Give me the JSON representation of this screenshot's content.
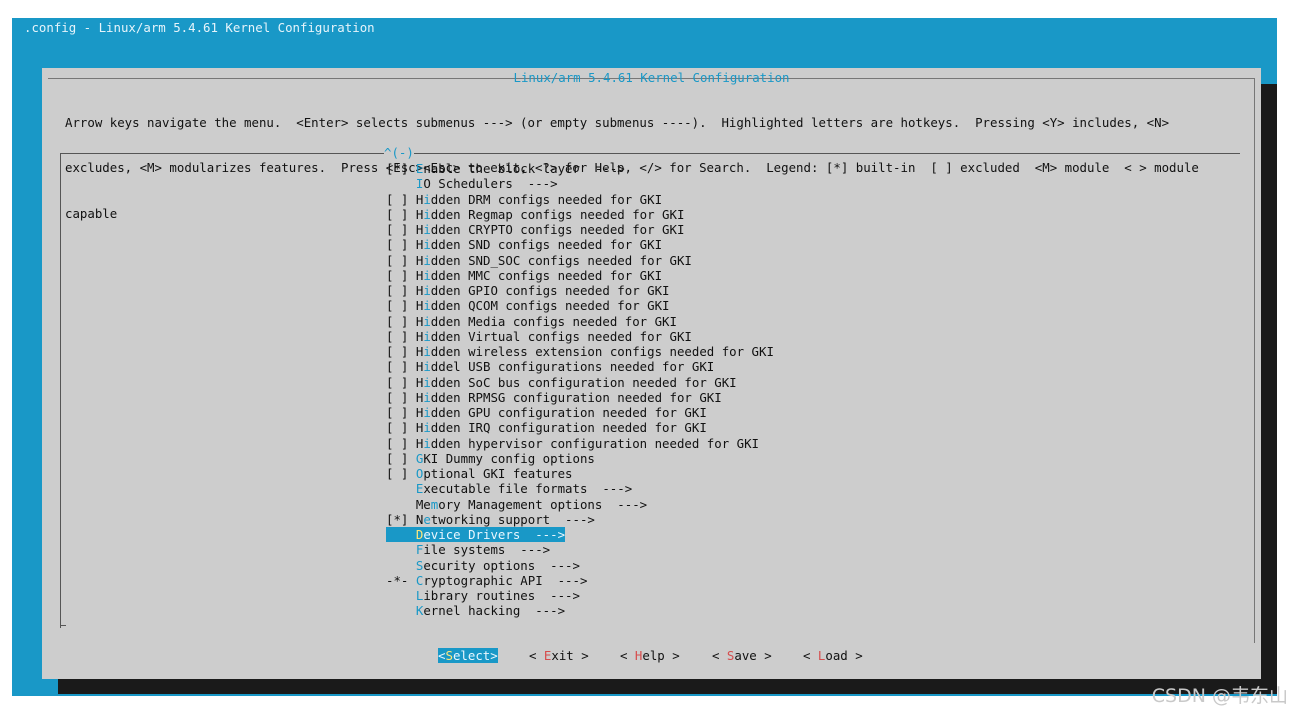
{
  "window": {
    "title": ".config - Linux/arm 5.4.61 Kernel Configuration"
  },
  "dialog": {
    "title": "Linux/arm 5.4.61 Kernel Configuration",
    "help_lines": [
      "Arrow keys navigate the menu.  <Enter> selects submenus ---> (or empty submenus ----).  Highlighted letters are hotkeys.  Pressing <Y> includes, <N>",
      "excludes, <M> modularizes features.  Press <Esc><Esc> to exit, <?> for Help, </> for Search.  Legend: [*] built-in  [ ] excluded  <M> module  < > module",
      "capable"
    ],
    "scroll_indicator": "^(-)"
  },
  "menu": {
    "items": [
      {
        "prefix": "[*] ",
        "hot": "E",
        "rest": "nable the block layer  --->"
      },
      {
        "prefix": "    ",
        "hot": "I",
        "rest": "O Schedulers  --->"
      },
      {
        "prefix": "[ ] ",
        "hot": "",
        "pre": "H",
        "hot2": "i",
        "rest": "dden DRM configs needed for GKI"
      },
      {
        "prefix": "[ ] ",
        "hot": "",
        "pre": "H",
        "hot2": "i",
        "rest": "dden Regmap configs needed for GKI"
      },
      {
        "prefix": "[ ] ",
        "hot": "",
        "pre": "H",
        "hot2": "i",
        "rest": "dden CRYPTO configs needed for GKI"
      },
      {
        "prefix": "[ ] ",
        "hot": "",
        "pre": "H",
        "hot2": "i",
        "rest": "dden SND configs needed for GKI"
      },
      {
        "prefix": "[ ] ",
        "hot": "",
        "pre": "H",
        "hot2": "i",
        "rest": "dden SND_SOC configs needed for GKI"
      },
      {
        "prefix": "[ ] ",
        "hot": "",
        "pre": "H",
        "hot2": "i",
        "rest": "dden MMC configs needed for GKI"
      },
      {
        "prefix": "[ ] ",
        "hot": "",
        "pre": "H",
        "hot2": "i",
        "rest": "dden GPIO configs needed for GKI"
      },
      {
        "prefix": "[ ] ",
        "hot": "",
        "pre": "H",
        "hot2": "i",
        "rest": "dden QCOM configs needed for GKI"
      },
      {
        "prefix": "[ ] ",
        "hot": "",
        "pre": "H",
        "hot2": "i",
        "rest": "dden Media configs needed for GKI"
      },
      {
        "prefix": "[ ] ",
        "hot": "",
        "pre": "H",
        "hot2": "i",
        "rest": "dden Virtual configs needed for GKI"
      },
      {
        "prefix": "[ ] ",
        "hot": "",
        "pre": "H",
        "hot2": "i",
        "rest": "dden wireless extension configs needed for GKI"
      },
      {
        "prefix": "[ ] ",
        "hot": "",
        "pre": "H",
        "hot2": "i",
        "rest": "ddel USB configurations needed for GKI"
      },
      {
        "prefix": "[ ] ",
        "hot": "",
        "pre": "H",
        "hot2": "i",
        "rest": "dden SoC bus configuration needed for GKI"
      },
      {
        "prefix": "[ ] ",
        "hot": "",
        "pre": "H",
        "hot2": "i",
        "rest": "dden RPMSG configuration needed for GKI"
      },
      {
        "prefix": "[ ] ",
        "hot": "",
        "pre": "H",
        "hot2": "i",
        "rest": "dden GPU configuration needed for GKI"
      },
      {
        "prefix": "[ ] ",
        "hot": "",
        "pre": "H",
        "hot2": "i",
        "rest": "dden IRQ configuration needed for GKI"
      },
      {
        "prefix": "[ ] ",
        "hot": "",
        "pre": "H",
        "hot2": "i",
        "rest": "dden hypervisor configuration needed for GKI"
      },
      {
        "prefix": "[ ] ",
        "hot": "G",
        "rest": "KI Dummy config options"
      },
      {
        "prefix": "[ ] ",
        "hot": "O",
        "rest": "ptional GKI features"
      },
      {
        "prefix": "    ",
        "hot": "E",
        "rest": "xecutable file formats  --->"
      },
      {
        "prefix": "    ",
        "hot": "",
        "pre": "Me",
        "hot2": "m",
        "rest": "ory Management options  --->"
      },
      {
        "prefix": "[*] ",
        "hot": "",
        "pre": "N",
        "hot2": "e",
        "rest": "tworking support  --->"
      },
      {
        "prefix": "    ",
        "hot": "D",
        "rest": "evice Drivers  --->",
        "selected": true
      },
      {
        "prefix": "    ",
        "hot": "F",
        "rest": "ile systems  --->"
      },
      {
        "prefix": "    ",
        "hot": "S",
        "rest": "ecurity options  --->"
      },
      {
        "prefix": "-*- ",
        "hot": "C",
        "rest": "ryptographic API  --->"
      },
      {
        "prefix": "    ",
        "hot": "L",
        "rest": "ibrary routines  --->"
      },
      {
        "prefix": "    ",
        "hot": "K",
        "rest": "ernel hacking  --->"
      }
    ]
  },
  "buttons": [
    {
      "open": "<",
      "hot": "S",
      "rest": "elect",
      "close": ">",
      "active": true
    },
    {
      "open": "< ",
      "hot": "E",
      "rest": "xit",
      "close": " >"
    },
    {
      "open": "< ",
      "hot": "H",
      "rest": "elp",
      "close": " >"
    },
    {
      "open": "< ",
      "hot": "S",
      "rest": "ave",
      "close": " >"
    },
    {
      "open": "< ",
      "hot": "L",
      "rest": "oad",
      "close": " >"
    }
  ],
  "watermark": "CSDN @韦东山"
}
